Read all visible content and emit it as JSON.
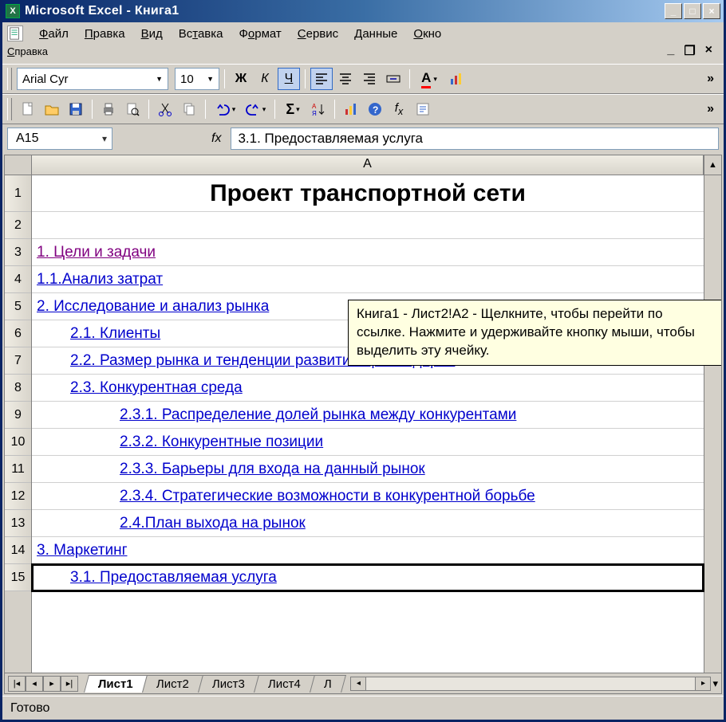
{
  "title": "Microsoft Excel - Книга1",
  "menus": [
    "Файл",
    "Правка",
    "Вид",
    "Вставка",
    "Формат",
    "Сервис",
    "Данные",
    "Окно",
    "Справка"
  ],
  "menu_underline_idx": [
    0,
    0,
    0,
    2,
    1,
    0,
    0,
    0,
    0
  ],
  "font_name": "Arial Cyr",
  "font_size": "10",
  "name_box": "A15",
  "fx": "fx",
  "formula": "3.1. Предоставляемая услуга",
  "col_header": "A",
  "row_numbers": [
    "1",
    "2",
    "3",
    "4",
    "5",
    "6",
    "7",
    "8",
    "9",
    "10",
    "11",
    "12",
    "13",
    "14",
    "15"
  ],
  "rows": [
    {
      "text": "Проект транспортной сети",
      "cls": "r1",
      "link": false
    },
    {
      "text": "",
      "cls": "",
      "link": false
    },
    {
      "text": "1. Цели и задачи",
      "cls": "",
      "link": "visited"
    },
    {
      "text": "1.1.Анализ затрат",
      "cls": "",
      "link": "link"
    },
    {
      "text": "2. Исследование и анализ рынка",
      "cls": "",
      "link": "link"
    },
    {
      "text": "2.1. Клиенты",
      "cls": "ind1",
      "link": "link"
    },
    {
      "text": "2.2. Размер рынка и тенденции развития провайдеров",
      "cls": "ind1",
      "link": "link"
    },
    {
      "text": "2.3. Конкурентная среда",
      "cls": "ind1",
      "link": "link"
    },
    {
      "text": "2.3.1. Распределение долей рынка между конкурентами",
      "cls": "ind2",
      "link": "link"
    },
    {
      "text": "2.3.2. Конкурентные позиции",
      "cls": "ind2",
      "link": "link"
    },
    {
      "text": "2.3.3. Барьеры для входа на данный рынок",
      "cls": "ind2",
      "link": "link"
    },
    {
      "text": "2.3.4. Стратегические возможности в конкурентной борьбе",
      "cls": "ind2",
      "link": "link"
    },
    {
      "text": "2.4.План выхода на рынок",
      "cls": "ind2",
      "link": "link"
    },
    {
      "text": "3. Маркетинг",
      "cls": "",
      "link": "link"
    },
    {
      "text": "3.1. Предоставляемая услуга",
      "cls": "ind1 selected",
      "link": "link"
    }
  ],
  "tooltip": "Книга1 - Лист2!A2 - Щелкните, чтобы перейти по ссылке. Нажмите и удерживайте кнопку мыши, чтобы выделить эту ячейку.",
  "tabs": [
    "Лист1",
    "Лист2",
    "Лист3",
    "Лист4",
    "Л"
  ],
  "active_tab": 0,
  "status": "Готово"
}
